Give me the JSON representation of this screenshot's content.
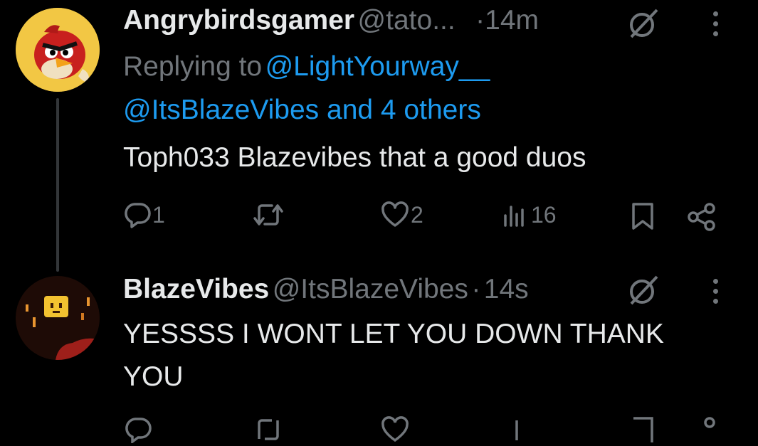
{
  "tweet1": {
    "display_name": "Angrybirdsgamer",
    "handle": "@tato...",
    "sep": "·",
    "time": "14m",
    "replying_prefix": "Replying to",
    "reply_handle1": "@LightYourway__",
    "reply_handle2": "@ItsBlazeVibes and 4 others",
    "text": "Toph033 Blazevibes that a good duos",
    "actions": {
      "reply_count": "1",
      "retweet_count": "",
      "like_count": "2",
      "views_count": "16"
    }
  },
  "tweet2": {
    "display_name": "BlazeVibes",
    "handle": "@ItsBlazeVibes",
    "sep": "·",
    "time": "14s",
    "text_line1": "YESSSS I WONT LET YOU DOWN THANK",
    "text_line2": "YOU"
  },
  "colors": {
    "background": "#000000",
    "text": "#e7e9ea",
    "muted": "#71767b",
    "link": "#1d9bf0"
  },
  "icons": [
    "grok-icon",
    "more-icon",
    "reply-icon",
    "retweet-icon",
    "like-icon",
    "views-icon",
    "bookmark-icon",
    "share-icon"
  ]
}
